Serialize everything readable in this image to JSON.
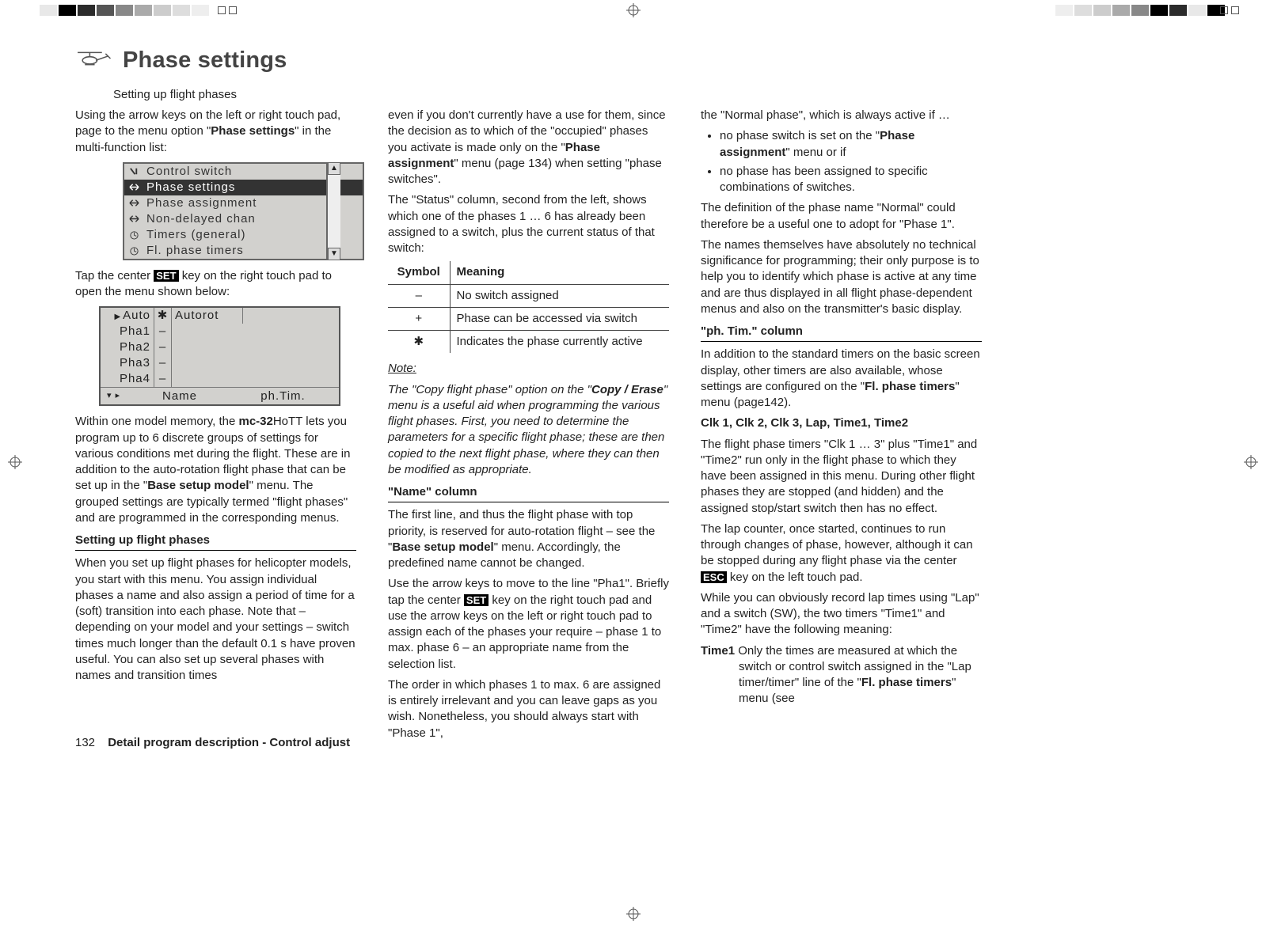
{
  "title": "Phase settings",
  "subtitle": "Setting up flight phases",
  "col1": {
    "p1a": "Using the arrow keys on the left or right touch pad, page to the menu option \"",
    "p1b": "Phase settings",
    "p1c": "\" in the multi-function list:",
    "menu": {
      "items": [
        "Control switch",
        "Phase settings",
        "Phase assignment",
        "Non-delayed chan",
        "Timers (general)",
        "Fl. phase timers"
      ]
    },
    "p2a": "Tap the center ",
    "set": "SET",
    "p2b": " key on the right touch pad to open the menu shown below:",
    "phasetable": {
      "rows": [
        {
          "c1": "Auto",
          "c2": "✱",
          "c3": "Autorot"
        },
        {
          "c1": "Pha1",
          "c2": "–",
          "c3": ""
        },
        {
          "c1": "Pha2",
          "c2": "–",
          "c3": ""
        },
        {
          "c1": "Pha3",
          "c2": "–",
          "c3": ""
        },
        {
          "c1": "Pha4",
          "c2": "–",
          "c3": ""
        }
      ],
      "footer": {
        "name": "Name",
        "phtim": "ph.Tim."
      }
    },
    "p3a": "Within one model memory, the ",
    "mc32": "mc-32",
    "p3b": "HoTT lets you program up to 6 discrete groups of settings for various conditions met during the flight. These are in addition to the auto-rotation flight phase that can be set up in the \"",
    "p3bold": "Base setup model",
    "p3c": "\" menu. The grouped settings are typically termed \"flight phases\" and are programmed in the corresponding menus.",
    "sect1": "Setting up flight phases",
    "p4": "When you set up flight phases for helicopter models, you start with this menu. You assign individual phases a name and also assign a period of time for a (soft) transition into each phase. Note that – depending on your model and your settings – switch times much longer than the default 0.1 s have proven useful. You can also set up several phases with names and transition times"
  },
  "col2": {
    "p1a": "even if you don't currently have a use for them, since the decision as to which of the \"occupied\" phases you activate is made only on the \"",
    "p1b": "Phase assignment",
    "p1c": "\" menu (page 134) when setting \"phase switches\".",
    "p2": "The \"Status\" column, second from the left, shows which one of the phases 1 … 6 has already been assigned to a switch, plus the current status of that switch:",
    "table": {
      "h1": "Symbol",
      "h2": "Meaning",
      "r1a": "–",
      "r1b": "No switch assigned",
      "r2a": "+",
      "r2b": "Phase can be accessed via switch",
      "r3a": "✱",
      "r3b": "Indicates the phase currently active"
    },
    "notehead": "Note:",
    "note_a": "The \"Copy flight phase\" option on the \"",
    "note_b": "Copy / Erase",
    "note_c": "\" menu is a useful aid when programming the various flight phases. First, you need to determine the parameters for a specific flight phase; these are then copied to the next flight phase, where they can then be modified as appropriate.",
    "sectname": "\"Name\" column",
    "p3a": "The first line, and thus the flight phase with top priority, is reserved for auto-rotation flight – see the \"",
    "p3b": "Base setup model",
    "p3c": "\" menu. Accordingly, the predefined name cannot be changed.",
    "p4a": "Use the arrow keys to move to the line \"Pha1\". Briefly tap the center ",
    "p4b": " key on the right touch pad and use the arrow keys on the left or right touch pad to assign each of the phases your require – phase 1 to max. phase 6 – an appropriate name from the selection list.",
    "p5": "The order in which phases 1 to max. 6 are assigned is entirely irrelevant and you can leave gaps as you wish. Nonetheless, you should always start with \"Phase 1\","
  },
  "col3": {
    "p1": "the \"Normal phase\", which is always active if …",
    "b1a": "no phase switch is set on the \"",
    "b1b": "Phase assignment",
    "b1c": "\" menu or if",
    "b2": "no phase has been assigned to specific combinations of switches.",
    "p2": "The definition of the phase name \"Normal\" could therefore be a useful one to adopt for \"Phase 1\".",
    "p3": "The names themselves have absolutely no technical significance for programming; their only purpose is to help you to identify which phase is active at any time and are thus displayed in all flight phase-dependent menus and also on the transmitter's basic display.",
    "sect": "\"ph. Tim.\" column",
    "p4a": "In addition to the standard timers on the basic screen display, other timers are also available, whose settings are configured on the \"",
    "p4b": "Fl. phase timers",
    "p4c": "\" menu (page142).",
    "clk": "Clk 1, Clk 2, Clk 3, Lap, Time1, Time2",
    "p5": "The flight phase timers \"Clk 1 … 3\" plus \"Time1\" and \"Time2\" run only in the flight phase to which they have been assigned in this menu. During other flight phases they are stopped (and hidden) and the assigned stop/start switch then has no effect.",
    "p6a": "The lap counter, once started, continues to run through changes of phase, however, although it can be stopped during any flight phase via the center ",
    "esc": "ESC",
    "p6b": " key on the left touch pad.",
    "p7": "While you can obviously record lap times using \"Lap\" and a switch (SW), the two timers \"Time1\" and \"Time2\" have the following meaning:",
    "t1a": "Time1",
    "t1b": " Only the times are measured at which the switch or control switch assigned in the \"Lap timer/timer\" line of the \"",
    "t1c": "Fl. phase timers",
    "t1d": "\" menu (see"
  },
  "footer": {
    "page": "132",
    "text": "Detail program description - Control adjust"
  }
}
